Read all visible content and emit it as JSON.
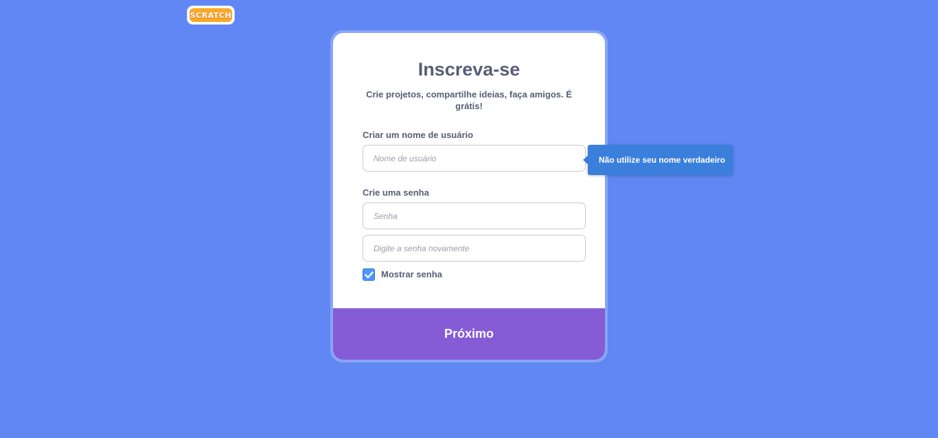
{
  "logo": {
    "text": "SCRATCH"
  },
  "form": {
    "title": "Inscreva-se",
    "subtitle": "Crie projetos, compartilhe ideias, faça amigos. É grátis!",
    "username_label": "Criar um nome de usuário",
    "username_placeholder": "Nome de usuário",
    "username_value": "",
    "password_label": "Crie uma senha",
    "password_placeholder": "Senha",
    "password_value": "",
    "password_confirm_placeholder": "Digite a senha novamente",
    "password_confirm_value": "",
    "show_password_label": "Mostrar senha",
    "show_password_checked": true,
    "next_button_label": "Próximo"
  },
  "tooltip": {
    "text": "Não utilize seu nome verdadeiro"
  },
  "colors": {
    "background": "#6087f3",
    "card": "#ffffff",
    "button": "#855cd6",
    "tooltip": "#3b7fdc",
    "checkbox": "#4c97ff",
    "text": "#575e75"
  },
  "icons": {
    "checkbox_check": "check-icon"
  }
}
